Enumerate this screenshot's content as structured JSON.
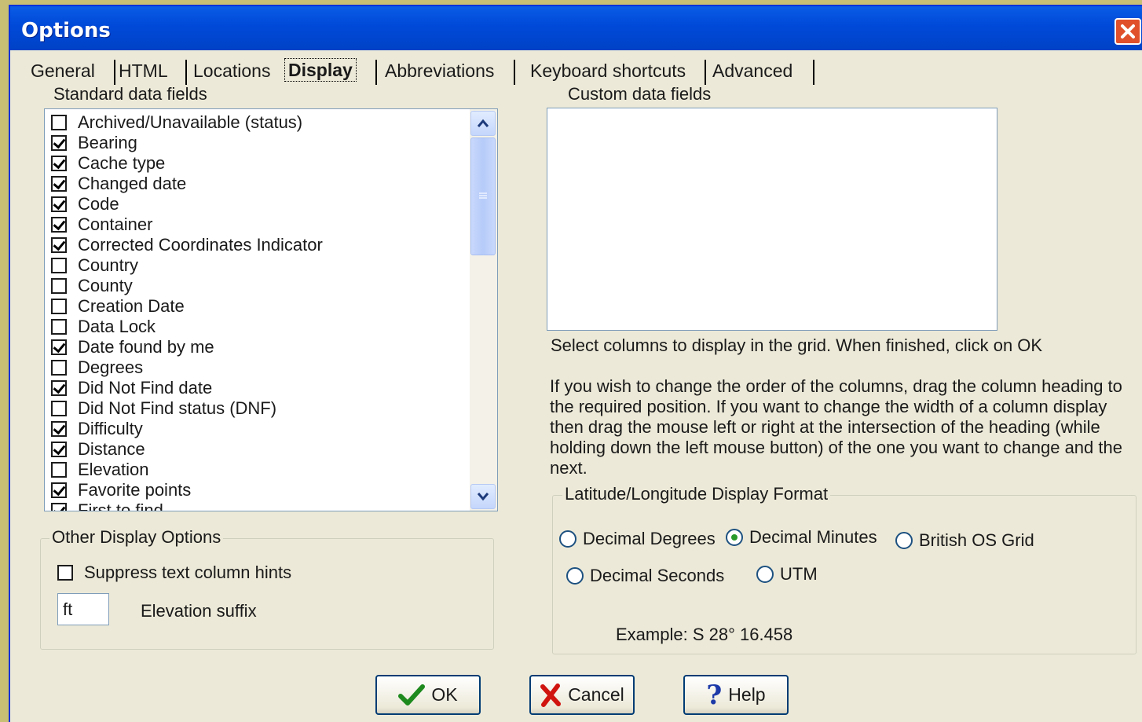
{
  "window": {
    "title": "Options"
  },
  "tabs": [
    {
      "label": "General"
    },
    {
      "label": "HTML"
    },
    {
      "label": "Locations"
    },
    {
      "label": "Display",
      "active": true
    },
    {
      "label": "Abbreviations"
    },
    {
      "label": "Keyboard shortcuts"
    },
    {
      "label": "Advanced"
    }
  ],
  "standard": {
    "label": "Standard data fields",
    "items": [
      {
        "label": "Archived/Unavailable (status)",
        "checked": false
      },
      {
        "label": "Bearing",
        "checked": true
      },
      {
        "label": "Cache type",
        "checked": true
      },
      {
        "label": "Changed date",
        "checked": true
      },
      {
        "label": "Code",
        "checked": true
      },
      {
        "label": "Container",
        "checked": true
      },
      {
        "label": "Corrected Coordinates Indicator",
        "checked": true
      },
      {
        "label": "Country",
        "checked": false
      },
      {
        "label": "County",
        "checked": false
      },
      {
        "label": "Creation Date",
        "checked": false
      },
      {
        "label": "Data Lock",
        "checked": false
      },
      {
        "label": "Date found by me",
        "checked": true
      },
      {
        "label": "Degrees",
        "checked": false
      },
      {
        "label": "Did Not Find date",
        "checked": true
      },
      {
        "label": "Did Not Find status (DNF)",
        "checked": false
      },
      {
        "label": "Difficulty",
        "checked": true
      },
      {
        "label": "Distance",
        "checked": true
      },
      {
        "label": "Elevation",
        "checked": false
      },
      {
        "label": "Favorite points",
        "checked": true
      },
      {
        "label": "First to find",
        "checked": true
      }
    ]
  },
  "custom": {
    "label": "Custom data fields"
  },
  "help_text_1": "Select columns to display in the grid. When finished, click on OK",
  "help_text_2": "If you wish to change the order of the columns, drag the column heading to the required position. If you want to change the width of a column display then drag the mouse left or right at the intersection of the heading (while holding down the left mouse button) of the one you want to change and the next.",
  "other": {
    "title": "Other Display Options",
    "suppress_label": "Suppress text column hints",
    "suppress_checked": false,
    "elevation_value": "ft",
    "elevation_label": "Elevation suffix"
  },
  "latlon": {
    "title": "Latitude/Longitude Display Format",
    "options": [
      {
        "label": "Decimal Degrees",
        "selected": false
      },
      {
        "label": "Decimal Minutes",
        "selected": true
      },
      {
        "label": "British OS Grid",
        "selected": false
      },
      {
        "label": "Decimal Seconds",
        "selected": false
      },
      {
        "label": "UTM",
        "selected": false
      }
    ],
    "example": "Example: S 28° 16.458"
  },
  "buttons": {
    "ok": "OK",
    "cancel": "Cancel",
    "help": "Help"
  },
  "colors": {
    "titlebar": "#0054e3",
    "window": "#ece9d8",
    "desktop": "#c9bf74",
    "close": "#e0502b"
  }
}
